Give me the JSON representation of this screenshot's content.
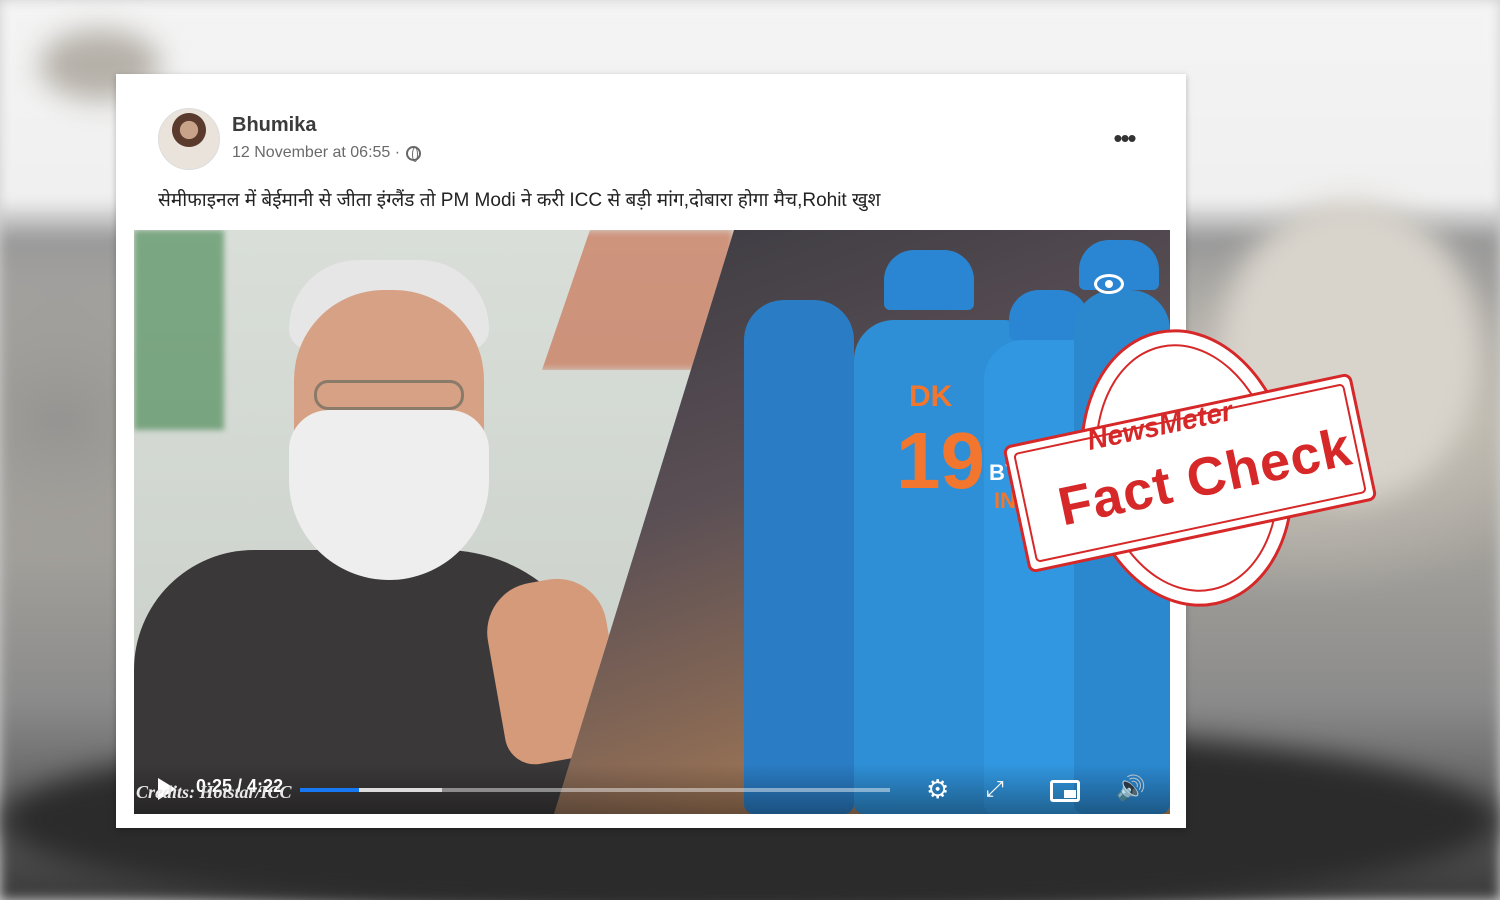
{
  "post": {
    "author": "Bhumika",
    "timestamp": "12 November at 06:55 ·",
    "privacy_icon": "globe-icon",
    "more_icon": "more-icon",
    "caption": "सेमीफाइनल में बेईमानी से जीता इंग्लैंड तो PM Modi ने करी ICC से बड़ी मांग,दोबारा होगा मैच,Rohit खुश"
  },
  "video": {
    "current_time": "0:25",
    "separator": " / ",
    "duration": "4:22",
    "progress_fraction": 0.1,
    "buffer_fraction": 0.24,
    "credits": "Credits: Hotstar/ICC",
    "jersey_name": "DK",
    "jersey_number": "19",
    "jersey_sponsor": "BYJ",
    "jersey_country": "INDI",
    "icons": [
      "play-icon",
      "settings-icon",
      "fullscreen-icon",
      "pip-icon",
      "volume-icon"
    ]
  },
  "stamp": {
    "brand": "NewsMeter",
    "label": "Fact Check",
    "color": "#d62828"
  },
  "colors": {
    "progress": "#1877f2",
    "jersey": "#2e8fd6",
    "jersey_number": "#f2762e"
  }
}
